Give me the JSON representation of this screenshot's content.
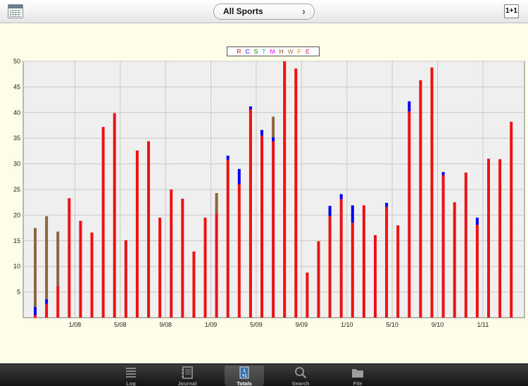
{
  "header": {
    "sport_selector": "All Sports",
    "plus_button": "1+1"
  },
  "legend": [
    {
      "label": "R",
      "color": "#ff0000"
    },
    {
      "label": "C",
      "color": "#0000ff"
    },
    {
      "label": "S",
      "color": "#008000"
    },
    {
      "label": "T",
      "color": "#00aaaa"
    },
    {
      "label": "M",
      "color": "#ff00ff"
    },
    {
      "label": "H",
      "color": "#8b4513"
    },
    {
      "label": "W",
      "color": "#aa7755"
    },
    {
      "label": "F",
      "color": "#ff8800"
    },
    {
      "label": "E",
      "color": "#cc3333"
    }
  ],
  "chart_data": {
    "type": "bar",
    "stacked": true,
    "ylim": [
      0,
      50
    ],
    "yticks": [
      5,
      10,
      15,
      20,
      25,
      30,
      35,
      40,
      45,
      50
    ],
    "x_tick_labels": [
      {
        "label": "1/08",
        "index": 3
      },
      {
        "label": "5/08",
        "index": 7
      },
      {
        "label": "9/08",
        "index": 11
      },
      {
        "label": "1/09",
        "index": 15
      },
      {
        "label": "5/09",
        "index": 19
      },
      {
        "label": "9/09",
        "index": 23
      },
      {
        "label": "1/10",
        "index": 27
      },
      {
        "label": "5/10",
        "index": 31
      },
      {
        "label": "9/10",
        "index": 35
      },
      {
        "label": "1/11",
        "index": 39
      }
    ],
    "grid": true,
    "series": [
      {
        "name": "R",
        "color": "#ee1111",
        "values": [
          0.5,
          2.7,
          6.2,
          23.3,
          18.9,
          16.6,
          37.2,
          39.9,
          15.1,
          32.6,
          34.4,
          19.5,
          25.0,
          23.2,
          12.9,
          19.5,
          20.3,
          30.8,
          26.0,
          40.6,
          35.5,
          34.4,
          50.0,
          48.6,
          8.8,
          14.9,
          19.8,
          23.1,
          18.5,
          21.9,
          16.1,
          21.6,
          18.0,
          40.2,
          46.3,
          48.8,
          27.8,
          22.5,
          28.3,
          18.1,
          31.0,
          30.9,
          38.2
        ]
      },
      {
        "name": "C",
        "color": "#0000ee",
        "values": [
          1.6,
          0.9,
          0,
          0,
          0,
          0,
          0,
          0,
          0,
          0,
          0,
          0,
          0,
          0,
          0,
          0,
          0,
          0.8,
          3.0,
          0.6,
          1.1,
          0.8,
          0,
          0,
          0,
          0,
          2.0,
          1.0,
          3.4,
          0,
          0,
          0.8,
          0,
          2.0,
          0,
          0,
          0.6,
          0,
          0,
          1.4,
          0,
          0,
          0
        ]
      },
      {
        "name": "H",
        "color": "#8b6640",
        "values": [
          15.4,
          16.2,
          10.6,
          0,
          0,
          0,
          0,
          0,
          0,
          0,
          0,
          0,
          0,
          0,
          0,
          0,
          4.0,
          0,
          0,
          0,
          0,
          4.0,
          0,
          0,
          0,
          0,
          0,
          0,
          0,
          0,
          0,
          0,
          0,
          0,
          0,
          0,
          0,
          0,
          0,
          0,
          0,
          0,
          0
        ]
      }
    ]
  },
  "tabs": [
    {
      "label": "Log",
      "active": false,
      "icon": "log-icon"
    },
    {
      "label": "Journal",
      "active": false,
      "icon": "journal-icon"
    },
    {
      "label": "Totals",
      "active": true,
      "icon": "totals-icon"
    },
    {
      "label": "Search",
      "active": false,
      "icon": "search-icon"
    },
    {
      "label": "File",
      "active": false,
      "icon": "file-icon"
    }
  ]
}
